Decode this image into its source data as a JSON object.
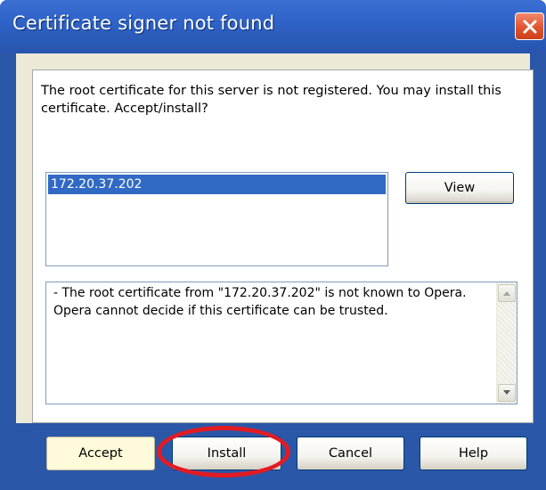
{
  "dialog": {
    "title": "Certificate signer not found",
    "message": "The root certificate for this server is not registered. You may install this certificate. Accept/install?",
    "certificates": [
      "172.20.37.202"
    ],
    "view_label": "View",
    "details_text": "- The root certificate from \"172.20.37.202\" is not known to Opera. Opera cannot decide if this certificate can be trusted."
  },
  "buttons": {
    "accept": "Accept",
    "install": "Install",
    "cancel": "Cancel",
    "help": "Help"
  },
  "icons": {
    "close": "close-icon",
    "scroll_up": "scroll-up-arrow-icon",
    "scroll_down": "scroll-down-arrow-icon"
  },
  "colors": {
    "titlebar": "#2f63c8",
    "selection": "#316ac5",
    "close_button": "#e2542f",
    "annotation": "#e31b23"
  }
}
